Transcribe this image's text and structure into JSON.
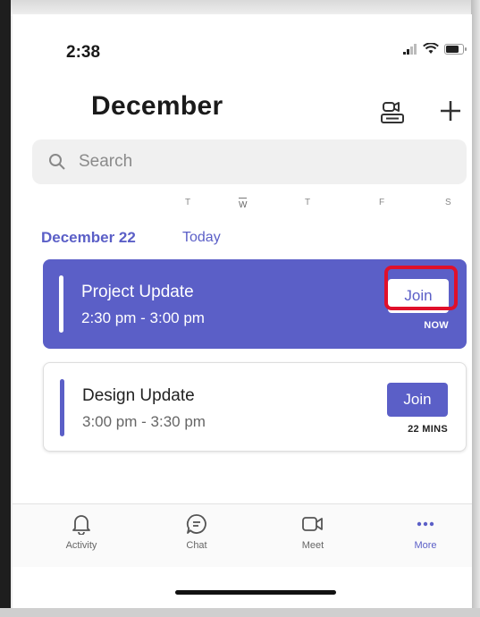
{
  "status": {
    "time": "2:38"
  },
  "header": {
    "title": "December"
  },
  "search": {
    "placeholder": "Search"
  },
  "week": [
    "T",
    "W",
    "T",
    "F",
    "S"
  ],
  "agenda": {
    "date": "December 22",
    "today": "Today"
  },
  "events": [
    {
      "title": "Project Update",
      "time": "2:30 pm - 3:00 pm",
      "join": "Join",
      "status": "NOW"
    },
    {
      "title": "Design Update",
      "time": "3:00 pm - 3:30 pm",
      "join": "Join",
      "status": "22 MINS"
    }
  ],
  "tabs": [
    {
      "label": "Activity",
      "icon": "bell-icon"
    },
    {
      "label": "Chat",
      "icon": "chat-icon"
    },
    {
      "label": "Meet",
      "icon": "video-icon"
    },
    {
      "label": "More",
      "icon": "more-icon"
    }
  ],
  "colors": {
    "accent": "#5b5fc7",
    "highlight": "#e0102a"
  }
}
